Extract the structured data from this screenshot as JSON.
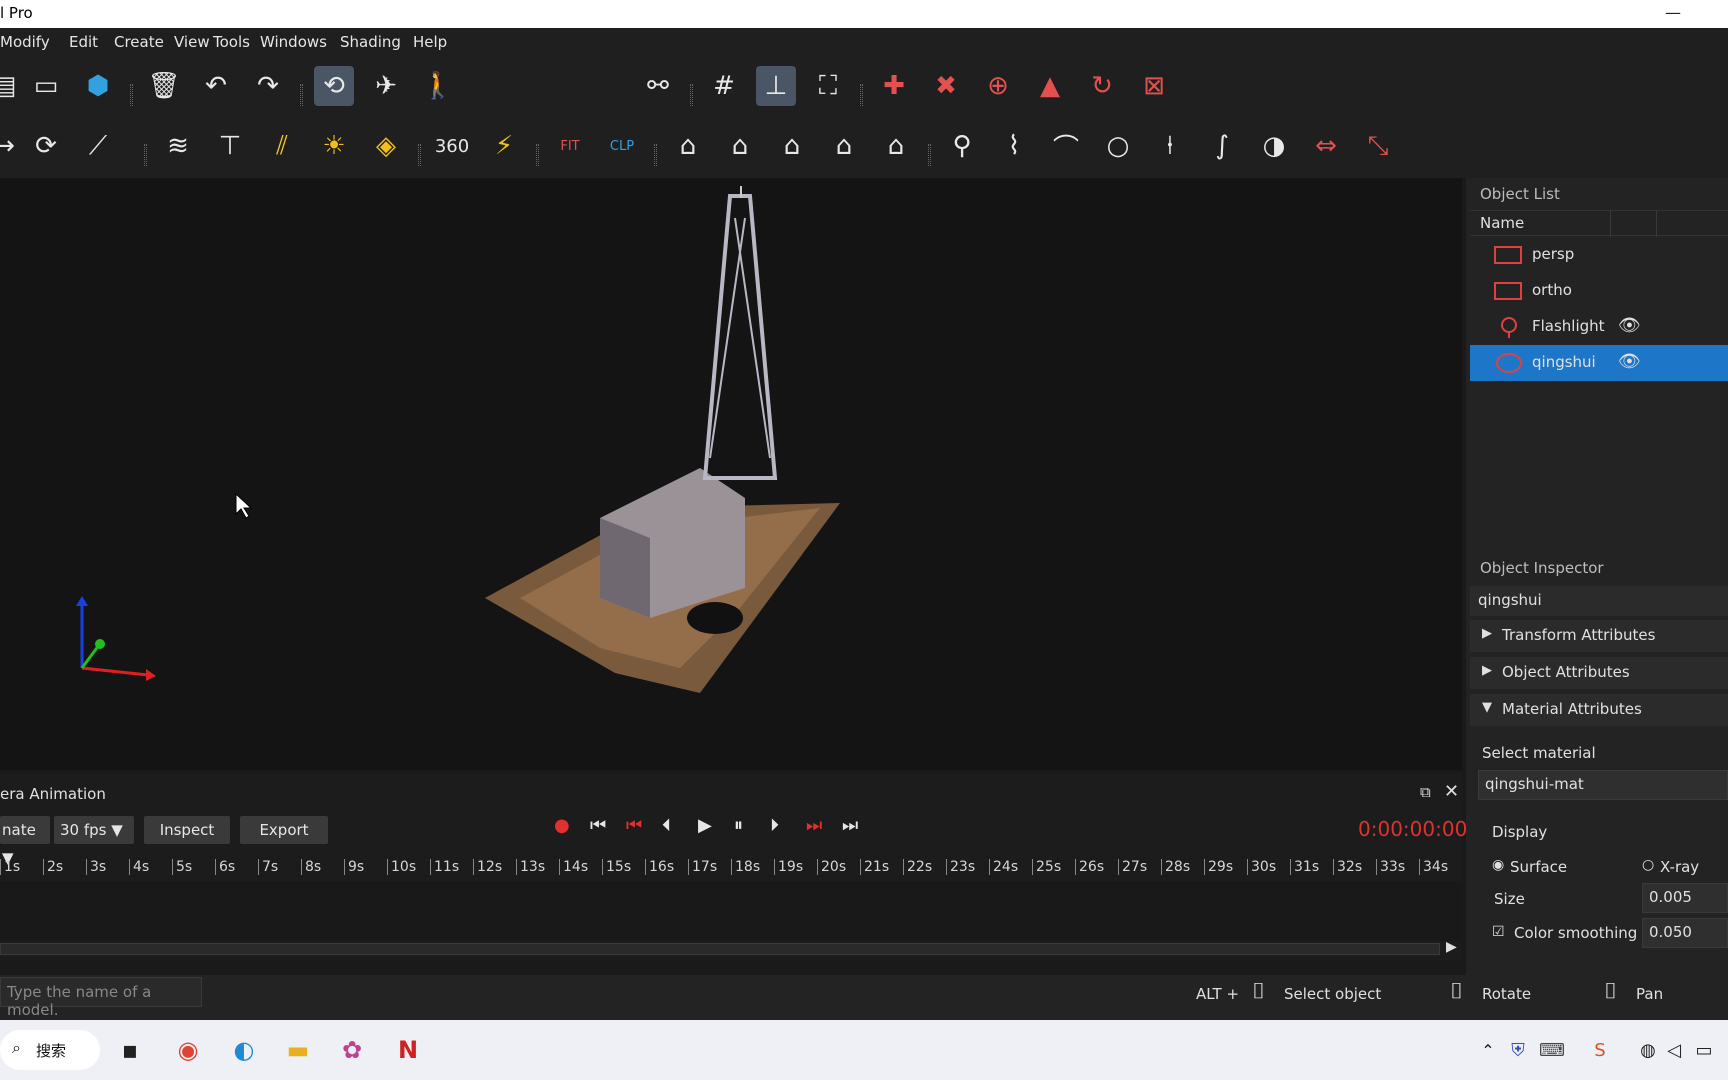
{
  "window": {
    "title": "l Pro",
    "minimize_glyph": "—"
  },
  "menu": [
    "Modify",
    "Edit",
    "Create",
    "View",
    "Tools",
    "Windows",
    "Shading",
    "Help"
  ],
  "toolbar": {
    "label_360": "360",
    "label_fit": "FIT",
    "label_clp": "CLP"
  },
  "object_list": {
    "title": "Object List",
    "column_name": "Name",
    "items": [
      {
        "label": "persp",
        "icon": "camera-icon",
        "visible": false,
        "selected": false
      },
      {
        "label": "ortho",
        "icon": "camera-icon",
        "visible": false,
        "selected": false
      },
      {
        "label": "Flashlight",
        "icon": "light-bulb-icon",
        "visible": true,
        "selected": false
      },
      {
        "label": "qingshui",
        "icon": "point-cloud-icon",
        "visible": true,
        "selected": true
      }
    ]
  },
  "inspector": {
    "title": "Object Inspector",
    "object_name": "qingshui",
    "sections": [
      {
        "label": "Transform Attributes",
        "expanded": false
      },
      {
        "label": "Object Attributes",
        "expanded": false
      },
      {
        "label": "Material Attributes",
        "expanded": true
      }
    ],
    "select_material_label": "Select material",
    "material_value": "qingshui-mat",
    "display_label": "Display",
    "display_options": [
      "Surface",
      "X-ray"
    ],
    "display_selected": "Surface",
    "size_label": "Size",
    "size_value": "0.005",
    "color_smoothing_label": "Color smoothing",
    "color_smoothing_value": "0.050",
    "color_smoothing_checked": true
  },
  "animation": {
    "title": "era Animation",
    "mode_value": "nate",
    "fps_value": "30 fps",
    "inspect_label": "Inspect",
    "export_label": "Export",
    "time": "0:00:00:00",
    "ticks": [
      "1s",
      "2s",
      "3s",
      "4s",
      "5s",
      "6s",
      "7s",
      "8s",
      "9s",
      "10s",
      "11s",
      "12s",
      "13s",
      "14s",
      "15s",
      "16s",
      "17s",
      "18s",
      "19s",
      "20s",
      "21s",
      "22s",
      "23s",
      "24s",
      "25s",
      "26s",
      "27s",
      "28s",
      "29s",
      "30s",
      "31s",
      "32s",
      "33s",
      "34s"
    ]
  },
  "status": {
    "search_placeholder": "Type the name of a model.",
    "alt_label": "ALT +",
    "select_label": "Select object",
    "rotate_label": "Rotate",
    "pan_label": "Pan"
  },
  "taskbar": {
    "search_label": "搜索"
  },
  "colors": {
    "accent": "#1e76c8",
    "timecode": "#e03030",
    "record": "#e03030"
  }
}
